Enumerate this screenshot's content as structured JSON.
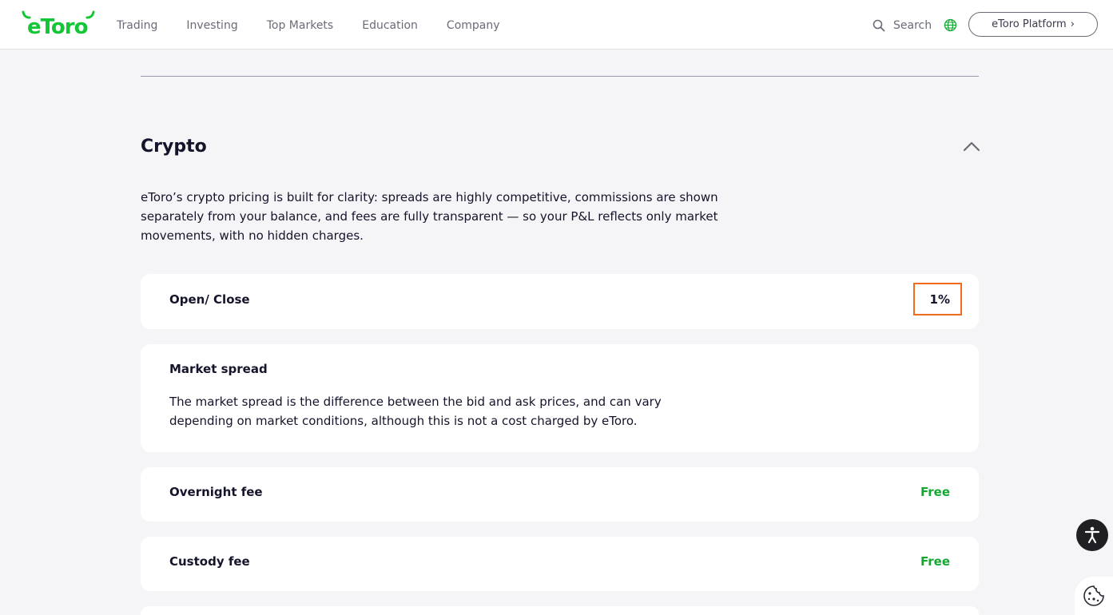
{
  "header": {
    "logo_text": "eToro",
    "nav": [
      "Trading",
      "Investing",
      "Top Markets",
      "Education",
      "Company"
    ],
    "search_label": "Search",
    "platform_button": "eToro Platform",
    "platform_chevron": "›"
  },
  "section": {
    "title": "Crypto",
    "intro": "eToro’s crypto pricing is built for clarity: spreads are highly competitive, commissions are shown separately from your balance, and fees are fully transparent — so your P&L reflects only market movements, with no hidden charges."
  },
  "fees": [
    {
      "label": "Open/ Close",
      "value": "1%"
    },
    {
      "label": "Market spread",
      "description": "The market spread is the difference between the bid and ask prices, and can vary depending on market conditions, although this is not a cost charged by eToro."
    },
    {
      "label": "Overnight fee",
      "value": "Free"
    },
    {
      "label": "Custody fee",
      "value": "Free"
    }
  ],
  "colors": {
    "brand_green": "#13c636",
    "free_green": "#13a832",
    "highlight_orange": "#f26b1d",
    "background": "#f5f5f7"
  },
  "icons": [
    "search-icon",
    "globe-icon",
    "chevron-up-icon",
    "accessibility-icon",
    "cookie-icon"
  ]
}
